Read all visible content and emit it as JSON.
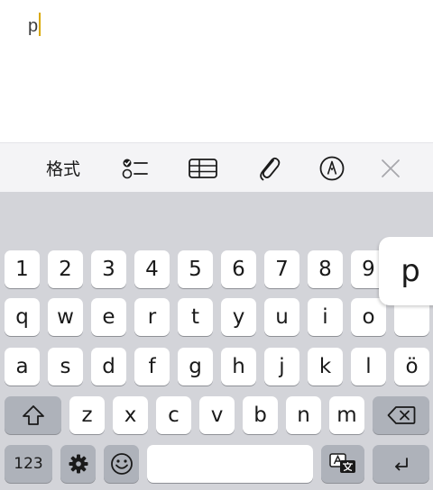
{
  "note": {
    "text": "p"
  },
  "toolbar": {
    "format_label": "格式",
    "icons": [
      "checklist-icon",
      "table-icon",
      "paperclip-icon",
      "markup-icon",
      "close-icon"
    ]
  },
  "keyboard": {
    "number_row": [
      "1",
      "2",
      "3",
      "4",
      "5",
      "6",
      "7",
      "8",
      "9"
    ],
    "row_q": [
      "q",
      "w",
      "e",
      "r",
      "t",
      "y",
      "u",
      "i",
      "o"
    ],
    "row_a": [
      "a",
      "s",
      "d",
      "f",
      "g",
      "h",
      "j",
      "k",
      "l",
      "ö"
    ],
    "row_z": [
      "z",
      "x",
      "c",
      "v",
      "b",
      "n",
      "m"
    ],
    "mode_key_label": "123",
    "popup_letter": "p"
  }
}
